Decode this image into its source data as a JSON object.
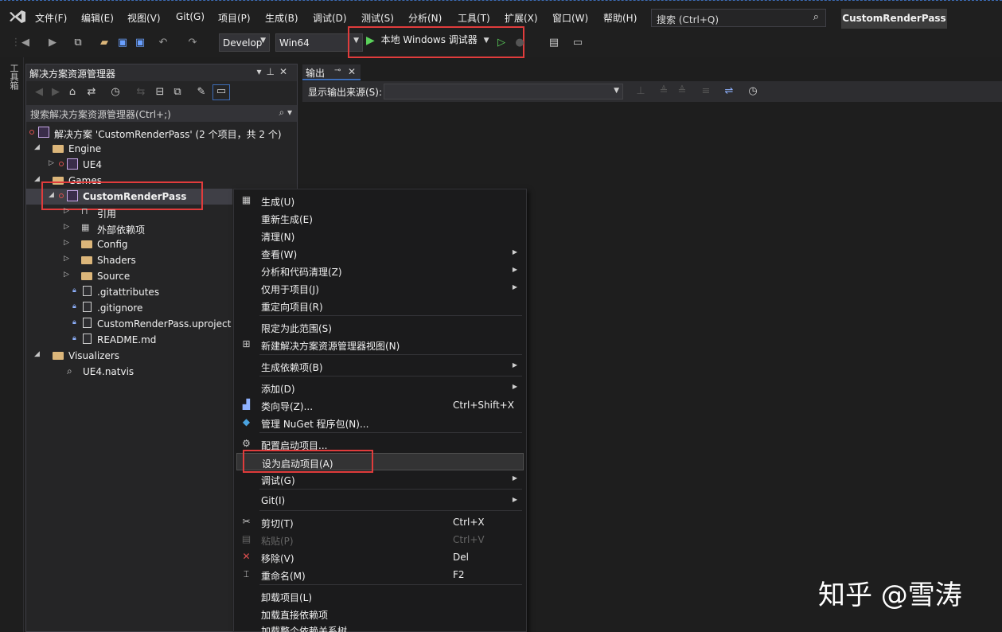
{
  "menubar": {
    "items": [
      "文件(F)",
      "编辑(E)",
      "视图(V)",
      "Git(G)",
      "项目(P)",
      "生成(B)",
      "调试(D)",
      "测试(S)",
      "分析(N)",
      "工具(T)",
      "扩展(X)",
      "窗口(W)",
      "帮助(H)"
    ],
    "search_placeholder": "搜索 (Ctrl+Q)",
    "solution_name": "CustomRenderPass"
  },
  "toolbar": {
    "configuration": "Develop",
    "platform": "Win64",
    "run_target": "本地 Windows 调试器"
  },
  "toolbox_rail": {
    "label": "工具箱"
  },
  "solution_explorer": {
    "title": "解决方案资源管理器",
    "search_placeholder": "搜索解决方案资源管理器(Ctrl+;)",
    "tree": [
      {
        "label": "解决方案 'CustomRenderPass' (2 个项目，共 2 个)"
      },
      {
        "label": "Engine"
      },
      {
        "label": "UE4"
      },
      {
        "label": "Games"
      },
      {
        "label": "CustomRenderPass"
      },
      {
        "label": "引用"
      },
      {
        "label": "外部依赖项"
      },
      {
        "label": "Config"
      },
      {
        "label": "Shaders"
      },
      {
        "label": "Source"
      },
      {
        "label": ".gitattributes"
      },
      {
        "label": ".gitignore"
      },
      {
        "label": "CustomRenderPass.uproject"
      },
      {
        "label": "README.md"
      },
      {
        "label": "Visualizers"
      },
      {
        "label": "UE4.natvis"
      }
    ]
  },
  "output": {
    "tab_label": "输出",
    "source_label": "显示输出来源(S):",
    "source_value": ""
  },
  "context_menu": {
    "items": [
      {
        "label": "生成(U)",
        "shortcut": ""
      },
      {
        "label": "重新生成(E)",
        "shortcut": ""
      },
      {
        "label": "清理(N)",
        "shortcut": ""
      },
      {
        "label": "查看(W)",
        "shortcut": ""
      },
      {
        "label": "分析和代码清理(Z)",
        "shortcut": ""
      },
      {
        "label": "仅用于项目(J)",
        "shortcut": ""
      },
      {
        "label": "重定向项目(R)",
        "shortcut": ""
      },
      {
        "label": "限定为此范围(S)",
        "shortcut": ""
      },
      {
        "label": "新建解决方案资源管理器视图(N)",
        "shortcut": ""
      },
      {
        "label": "生成依赖项(B)",
        "shortcut": ""
      },
      {
        "label": "添加(D)",
        "shortcut": ""
      },
      {
        "label": "类向导(Z)...",
        "shortcut": "Ctrl+Shift+X"
      },
      {
        "label": "管理 NuGet 程序包(N)...",
        "shortcut": ""
      },
      {
        "label": "配置启动项目...",
        "shortcut": ""
      },
      {
        "label": "设为启动项目(A)",
        "shortcut": ""
      },
      {
        "label": "调试(G)",
        "shortcut": ""
      },
      {
        "label": "Git(I)",
        "shortcut": ""
      },
      {
        "label": "剪切(T)",
        "shortcut": "Ctrl+X"
      },
      {
        "label": "粘贴(P)",
        "shortcut": "Ctrl+V"
      },
      {
        "label": "移除(V)",
        "shortcut": "Del"
      },
      {
        "label": "重命名(M)",
        "shortcut": "F2"
      },
      {
        "label": "卸载项目(L)",
        "shortcut": ""
      },
      {
        "label": "加载直接依赖项",
        "shortcut": ""
      },
      {
        "label": "加载整个依赖关系树",
        "shortcut": ""
      }
    ]
  },
  "watermark": "知乎 @雪涛",
  "colors": {
    "accent": "#3d6db8",
    "highlight_box": "#e03c3c",
    "run_green": "#5bd25b",
    "folder": "#dcb67a"
  }
}
